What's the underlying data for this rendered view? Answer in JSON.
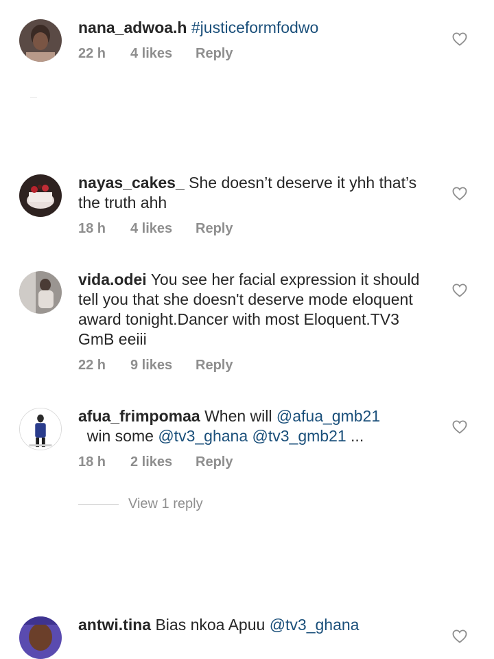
{
  "comments": [
    {
      "username": "nana_adwoa.h",
      "parts": [
        {
          "text": "#justiceformfodwo",
          "mention": true
        }
      ],
      "time": "22 h",
      "likes": "4 likes",
      "reply": "Reply"
    },
    {
      "username": "nayas_cakes_",
      "parts": [
        {
          "text": "She doesn’t deserve it yhh that’s the truth ahh",
          "mention": false
        }
      ],
      "time": "18 h",
      "likes": "4 likes",
      "reply": "Reply"
    },
    {
      "username": "vida.odei",
      "parts": [
        {
          "text": "You see her facial expression it should tell you that she doesn't deserve mode eloquent award tonight.Dancer with most Eloquent.TV3 GmB eeiii",
          "mention": false
        }
      ],
      "time": "22 h",
      "likes": "9 likes",
      "reply": "Reply"
    },
    {
      "username": "afua_frimpomaa",
      "parts": [
        {
          "text": "When will ",
          "mention": false
        },
        {
          "text": "@afua_gmb21",
          "mention": true
        },
        {
          "text": "  win some ",
          "mention": false
        },
        {
          "text": "@tv3_ghana",
          "mention": true
        },
        {
          "text": " ",
          "mention": false
        },
        {
          "text": "@tv3_gmb21",
          "mention": true
        },
        {
          "text": " ...",
          "mention": false
        }
      ],
      "time": "18 h",
      "likes": "2 likes",
      "reply": "Reply",
      "view_replies": "View 1 reply"
    },
    {
      "username": "antwi.tina",
      "parts": [
        {
          "text": "Bias nkoa Apuu ",
          "mention": false
        },
        {
          "text": "@tv3_ghana",
          "mention": true
        }
      ]
    }
  ],
  "colors": {
    "text": "#262626",
    "meta": "#8e8e8e",
    "mention": "#1a4f7a",
    "heart_stroke": "#8e8e8e"
  },
  "icons": {
    "like": "heart-outline-icon",
    "avatar": "user-avatar"
  }
}
